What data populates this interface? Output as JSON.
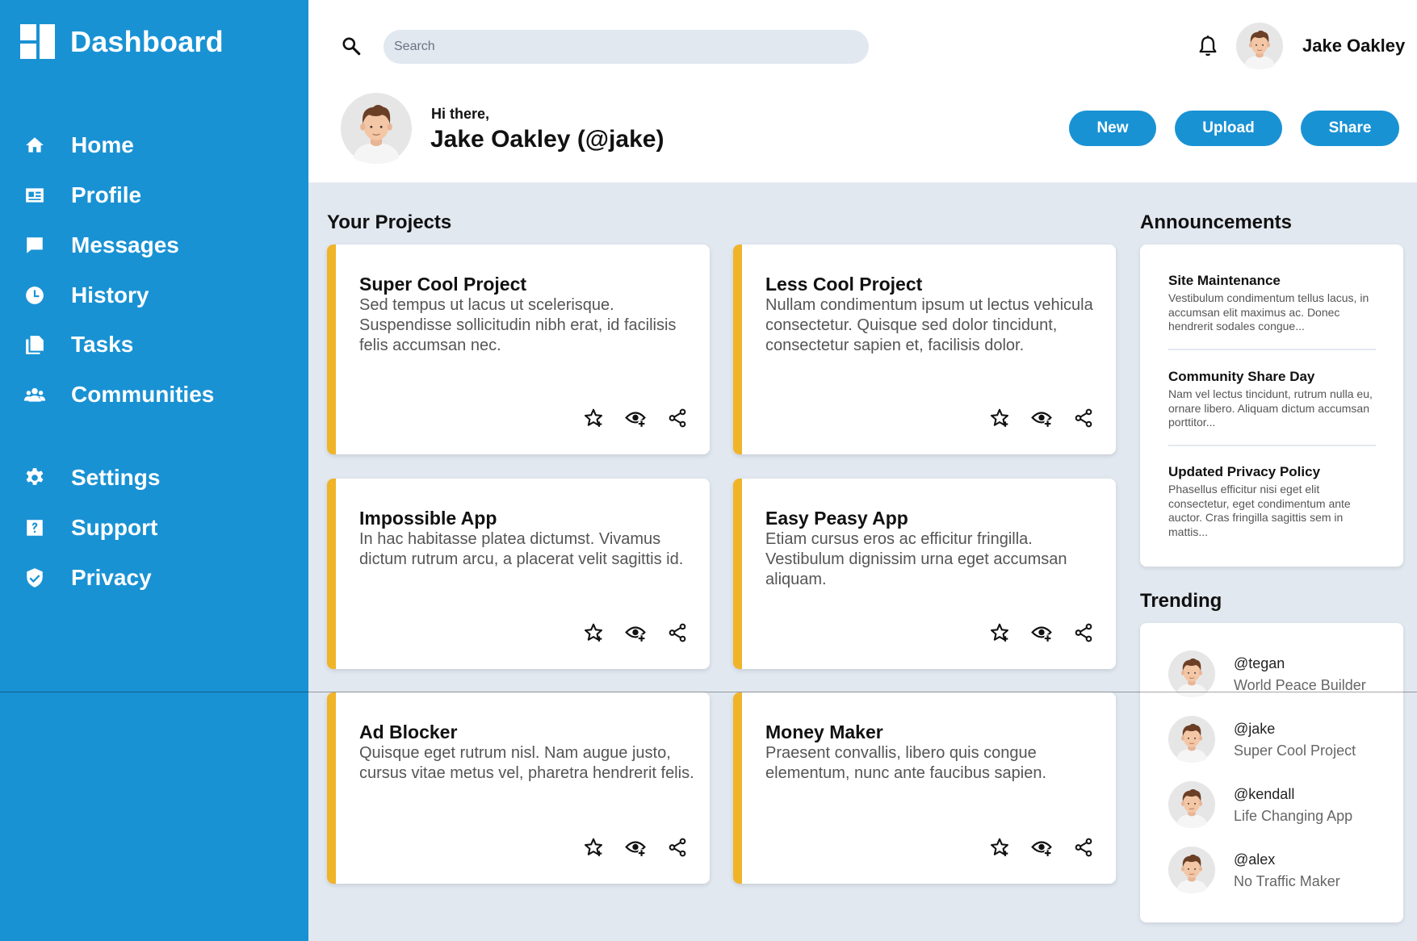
{
  "brand": {
    "title": "Dashboard"
  },
  "sidebar": {
    "items": [
      {
        "label": "Home",
        "icon": "home-icon"
      },
      {
        "label": "Profile",
        "icon": "id-card-icon"
      },
      {
        "label": "Messages",
        "icon": "chat-bubble-icon"
      },
      {
        "label": "History",
        "icon": "clock-icon"
      },
      {
        "label": "Tasks",
        "icon": "documents-icon"
      },
      {
        "label": "Communities",
        "icon": "group-icon"
      },
      {
        "label": "Settings",
        "icon": "gear-icon"
      },
      {
        "label": "Support",
        "icon": "help-icon"
      },
      {
        "label": "Privacy",
        "icon": "shield-check-icon"
      }
    ]
  },
  "header": {
    "search": {
      "placeholder": "Search",
      "value": ""
    },
    "user_name": "Jake Oakley",
    "greeting": "Hi there,",
    "greeting_name": "Jake Oakley (@jake)",
    "buttons": {
      "new": "New",
      "upload": "Upload",
      "share": "Share"
    }
  },
  "projects": {
    "title": "Your Projects",
    "items": [
      {
        "title": "Super Cool Project",
        "desc": "Sed tempus ut lacus ut scelerisque. Suspendisse sollicitudin nibh erat, id facilisis felis accumsan nec."
      },
      {
        "title": "Less Cool Project",
        "desc": "Nullam condimentum ipsum ut lectus vehicula consectetur. Quisque sed dolor tincidunt, consectetur sapien et, facilisis dolor."
      },
      {
        "title": "Impossible App",
        "desc": "In hac habitasse platea dictumst. Vivamus dictum rutrum arcu, a placerat velit sagittis id."
      },
      {
        "title": "Easy Peasy App",
        "desc": "Etiam cursus eros ac efficitur fringilla. Vestibulum dignissim urna eget accumsan aliquam."
      },
      {
        "title": "Ad Blocker",
        "desc": "Quisque eget rutrum nisl. Nam augue justo, cursus vitae metus vel, pharetra hendrerit felis."
      },
      {
        "title": "Money Maker",
        "desc": "Praesent convallis, libero quis congue elementum, nunc ante faucibus sapien."
      }
    ]
  },
  "announcements": {
    "title": "Announcements",
    "items": [
      {
        "title": "Site Maintenance",
        "body": "Vestibulum condimentum tellus lacus, in accumsan elit maximus ac. Donec hendrerit sodales congue..."
      },
      {
        "title": "Community Share Day",
        "body": "Nam vel lectus tincidunt, rutrum nulla eu, ornare libero. Aliquam dictum accumsan porttitor..."
      },
      {
        "title": "Updated Privacy Policy",
        "body": "Phasellus efficitur nisi eget elit consectetur, eget condimentum ante auctor. Cras fringilla sagittis sem in mattis..."
      }
    ]
  },
  "trending": {
    "title": "Trending",
    "items": [
      {
        "handle": "@tegan",
        "project": "World Peace Builder"
      },
      {
        "handle": "@jake",
        "project": "Super Cool Project"
      },
      {
        "handle": "@kendall",
        "project": "Life Changing App"
      },
      {
        "handle": "@alex",
        "project": "No Traffic Maker"
      }
    ]
  },
  "colors": {
    "primary": "#1992d4",
    "accent": "#f0b429",
    "background": "#e2e8f0"
  }
}
